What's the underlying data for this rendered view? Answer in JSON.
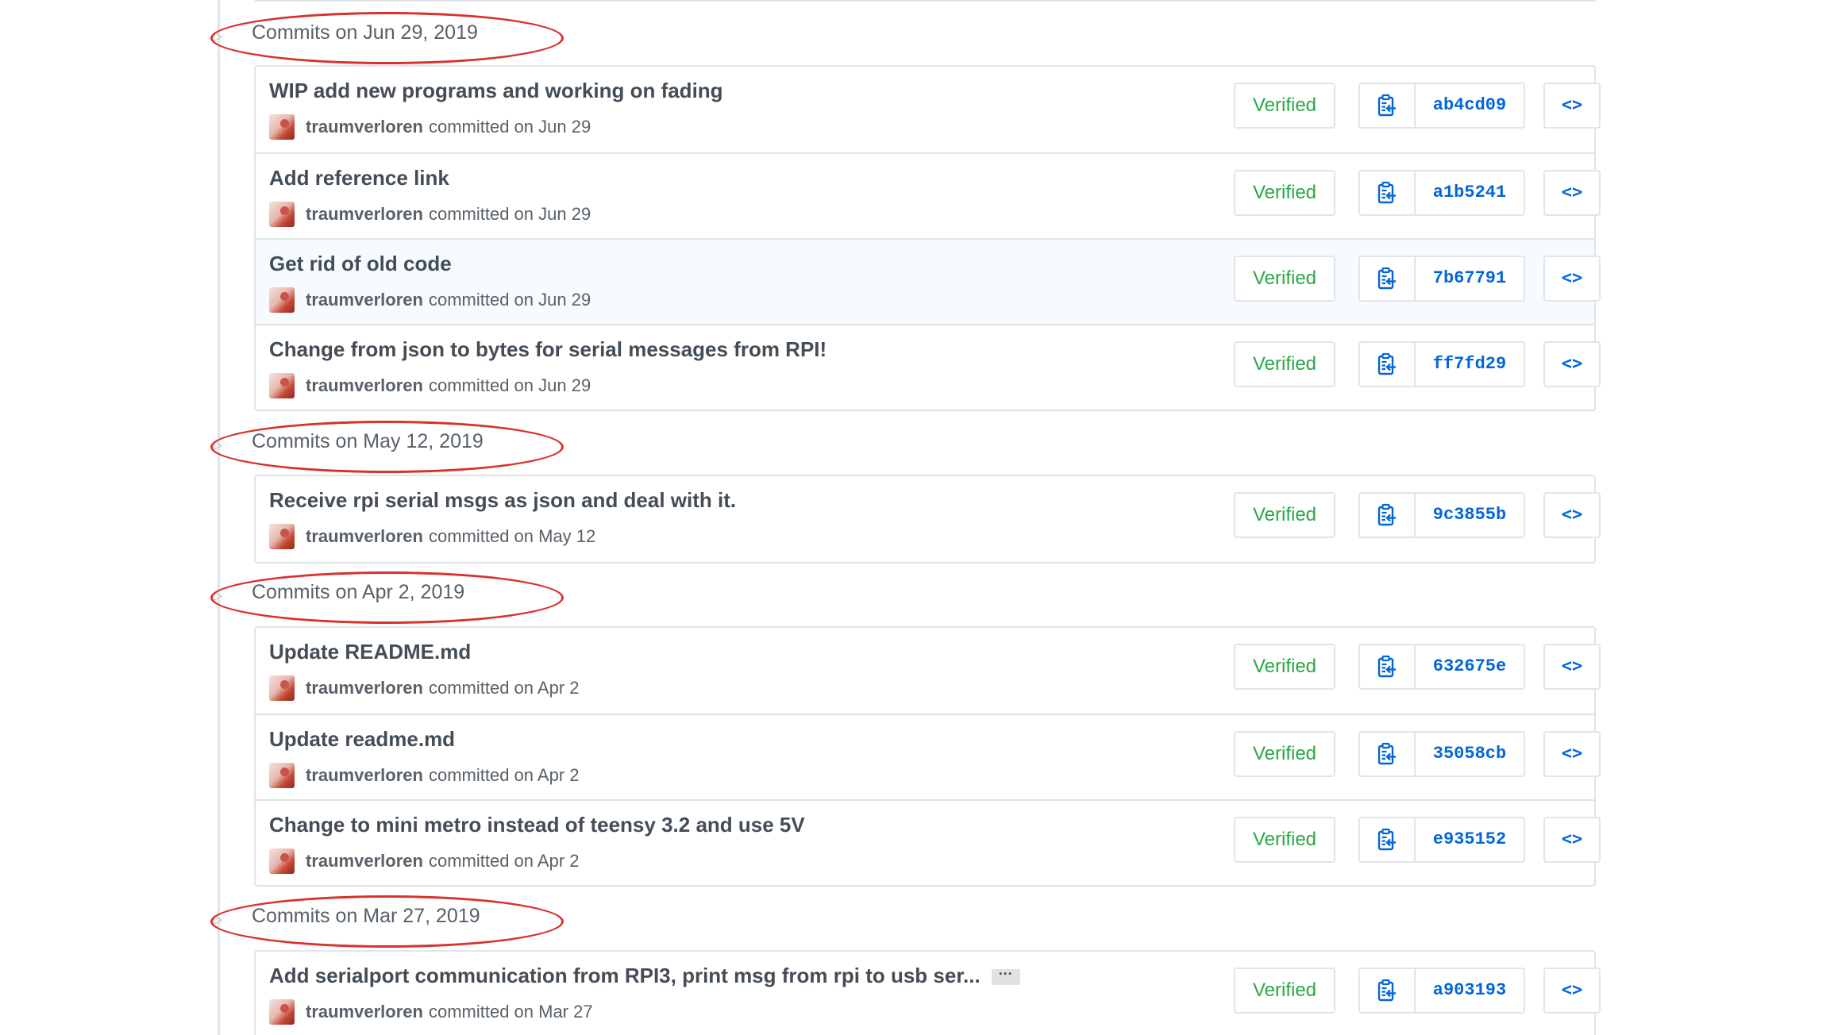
{
  "groups": [
    {
      "header": "Commits on Jun 29, 2019",
      "commits": [
        {
          "title": "WIP add new programs and working on fading",
          "author": "traumverloren",
          "meta": "committed on Jun 29",
          "verified": "Verified",
          "sha": "ab4cd09",
          "browse": "<>"
        },
        {
          "title": "Add reference link",
          "author": "traumverloren",
          "meta": "committed on Jun 29",
          "verified": "Verified",
          "sha": "a1b5241",
          "browse": "<>"
        },
        {
          "title": "Get rid of old code",
          "author": "traumverloren",
          "meta": "committed on Jun 29",
          "verified": "Verified",
          "sha": "7b67791",
          "browse": "<>"
        },
        {
          "title": "Change from json to bytes for serial messages from RPI!",
          "author": "traumverloren",
          "meta": "committed on Jun 29",
          "verified": "Verified",
          "sha": "ff7fd29",
          "browse": "<>"
        }
      ]
    },
    {
      "header": "Commits on May 12, 2019",
      "commits": [
        {
          "title": "Receive rpi serial msgs as json and deal with it.",
          "author": "traumverloren",
          "meta": "committed on May 12",
          "verified": "Verified",
          "sha": "9c3855b",
          "browse": "<>"
        }
      ]
    },
    {
      "header": "Commits on Apr 2, 2019",
      "commits": [
        {
          "title": "Update README.md",
          "author": "traumverloren",
          "meta": "committed on Apr 2",
          "verified": "Verified",
          "sha": "632675e",
          "browse": "<>"
        },
        {
          "title": "Update readme.md",
          "author": "traumverloren",
          "meta": "committed on Apr 2",
          "verified": "Verified",
          "sha": "35058cb",
          "browse": "<>"
        },
        {
          "title": "Change to mini metro instead of teensy 3.2 and use 5V",
          "author": "traumverloren",
          "meta": "committed on Apr 2",
          "verified": "Verified",
          "sha": "e935152",
          "browse": "<>"
        }
      ]
    },
    {
      "header": "Commits on Mar 27, 2019",
      "commits": [
        {
          "title": "Add serialport communication from RPI3, print msg from rpi to usb ser...",
          "ellipsis": "···",
          "author": "traumverloren",
          "meta": "committed on Mar 27",
          "verified": "Verified",
          "sha": "a903193",
          "browse": "<>"
        }
      ]
    }
  ],
  "icons": {
    "copy": "clippy-icon",
    "commit_dot": "git-commit-icon",
    "avatar": "user-avatar"
  },
  "colors": {
    "verified": "#28a745",
    "link": "#0366d6",
    "highlight_annotation": "#d7322b",
    "hover_row": "#f6fbff",
    "border": "#e1e4e8"
  }
}
